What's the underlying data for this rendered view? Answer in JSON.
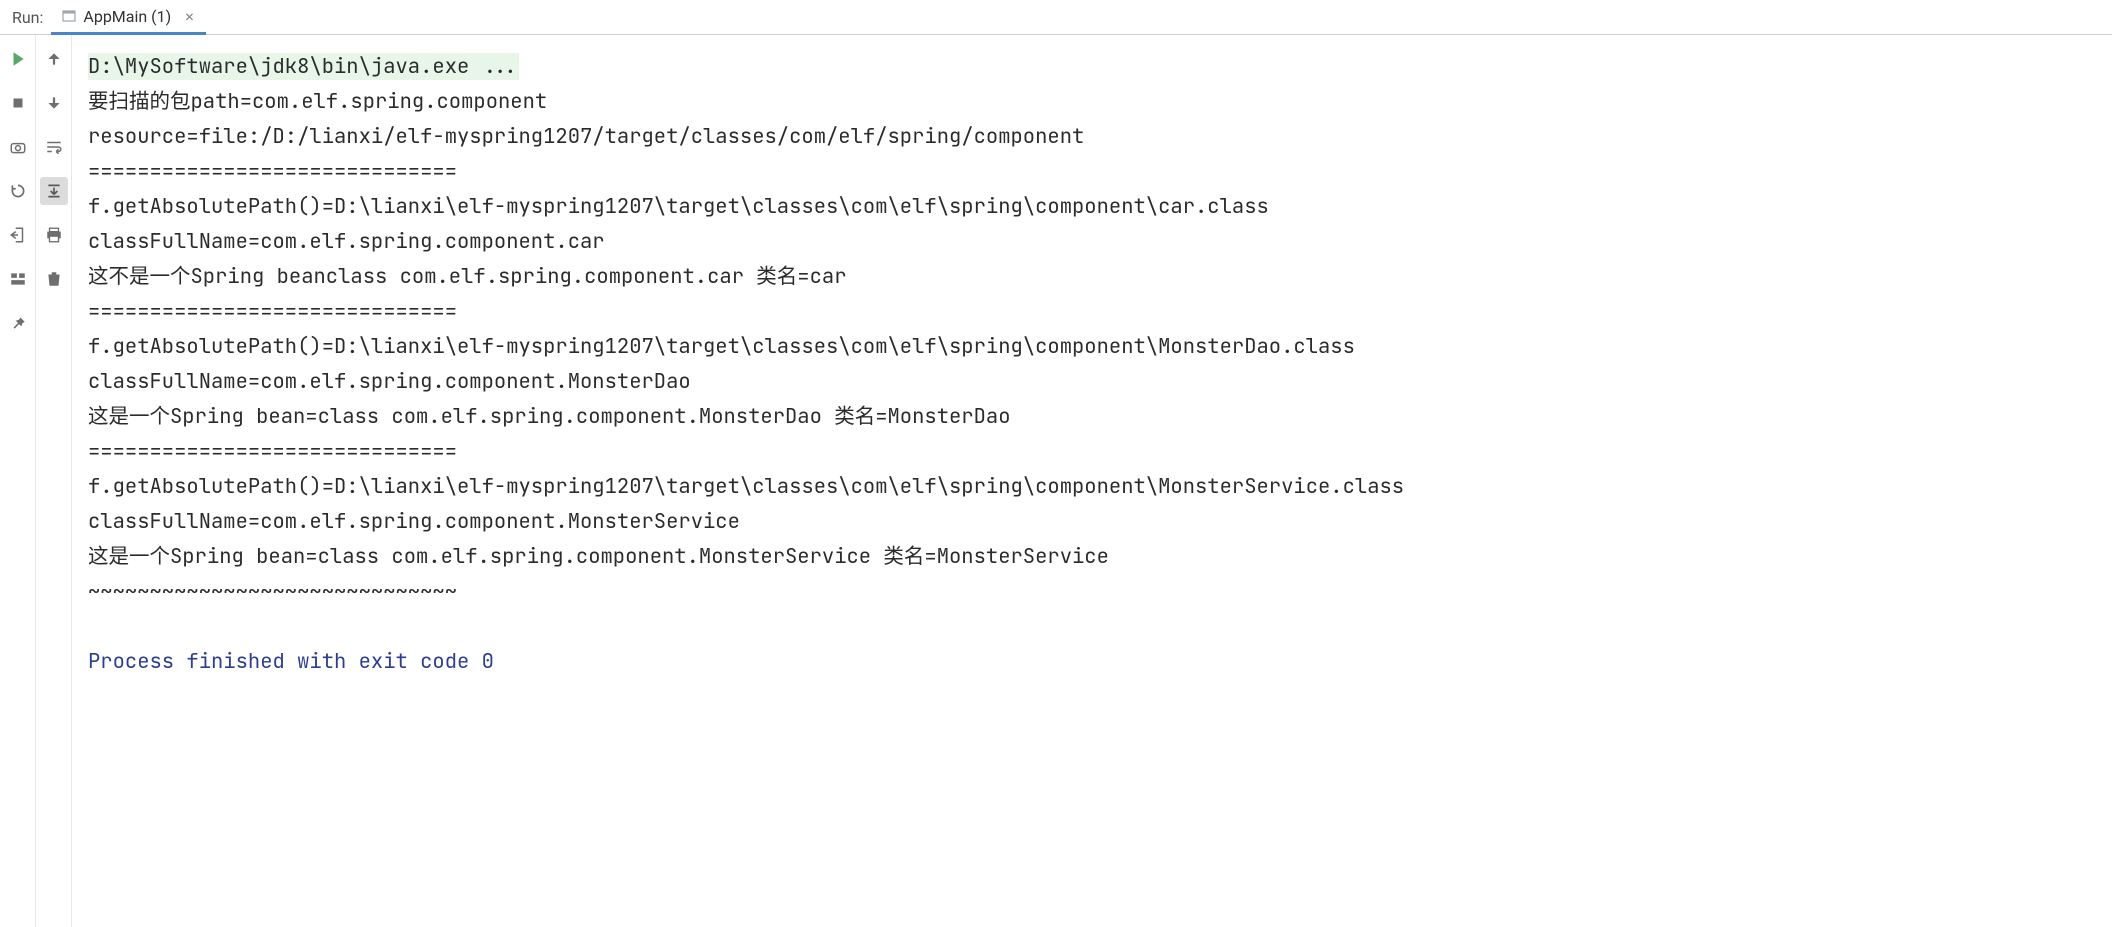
{
  "header": {
    "run_label": "Run:",
    "tab": {
      "title": "AppMain (1)",
      "close_glyph": "×"
    }
  },
  "console": {
    "command": "D:\\MySoftware\\jdk8\\bin\\java.exe ...",
    "lines": [
      "要扫描的包path=com.elf.spring.component",
      "resource=file:/D:/lianxi/elf-myspring1207/target/classes/com/elf/spring/component",
      "==============================",
      "f.getAbsolutePath()=D:\\lianxi\\elf-myspring1207\\target\\classes\\com\\elf\\spring\\component\\car.class",
      "classFullName=com.elf.spring.component.car",
      "这不是一个Spring beanclass com.elf.spring.component.car 类名=car",
      "==============================",
      "f.getAbsolutePath()=D:\\lianxi\\elf-myspring1207\\target\\classes\\com\\elf\\spring\\component\\MonsterDao.class",
      "classFullName=com.elf.spring.component.MonsterDao",
      "这是一个Spring bean=class com.elf.spring.component.MonsterDao 类名=MonsterDao",
      "==============================",
      "f.getAbsolutePath()=D:\\lianxi\\elf-myspring1207\\target\\classes\\com\\elf\\spring\\component\\MonsterService.class",
      "classFullName=com.elf.spring.component.MonsterService",
      "这是一个Spring bean=class com.elf.spring.component.MonsterService 类名=MonsterService",
      "~~~~~~~~~~~~~~~~~~~~~~~~~~~~~~"
    ],
    "blank": "",
    "exit_message": "Process finished with exit code 0"
  },
  "icons": {
    "play": "play-icon",
    "stop": "stop-icon",
    "camera": "camera-icon",
    "rerun_failed": "rerun-failed-icon",
    "exit": "exit-icon",
    "layout": "layout-icon",
    "pin": "pin-icon",
    "arrow_up": "arrow-up-icon",
    "arrow_down": "arrow-down-icon",
    "wrap": "wrap-icon",
    "scroll_end": "scroll-end-icon",
    "print": "print-icon",
    "trash": "trash-icon"
  }
}
